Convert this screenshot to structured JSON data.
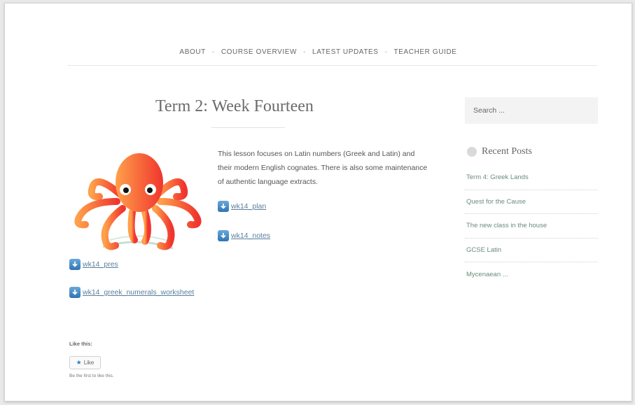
{
  "nav": {
    "items": [
      "ABOUT",
      "COURSE OVERVIEW",
      "LATEST UPDATES",
      "TEACHER GUIDE"
    ],
    "separator": "-"
  },
  "post": {
    "title": "Term 2: Week Fourteen",
    "intro": "This lesson focuses on Latin numbers (Greek and Latin) and their modern English cognates. There is also some maintenance of authentic language extracts.",
    "attachments": [
      "wk14_plan",
      "wk14_notes",
      "wk14_pres",
      "wk14_greek_numerals_worksheet"
    ]
  },
  "sidebar": {
    "search_placeholder": "Search ...",
    "recent_posts_title": "Recent Posts",
    "recent_posts": [
      "Term 4: Greek Lands",
      "Quest for the Cause",
      "The new class in the house",
      "GCSE Latin",
      "Mycenaean ..."
    ]
  },
  "like": {
    "label": "Like this:",
    "button": "Like",
    "note": "Be the first to like this."
  },
  "colors": {
    "link": "#5a7f9f",
    "sidebar_link": "#6d8b7a",
    "download_icon": "#3a86c8"
  },
  "icons": {
    "download": "download-arrow-icon",
    "like": "star-icon",
    "recent_posts": "circle-icon"
  }
}
